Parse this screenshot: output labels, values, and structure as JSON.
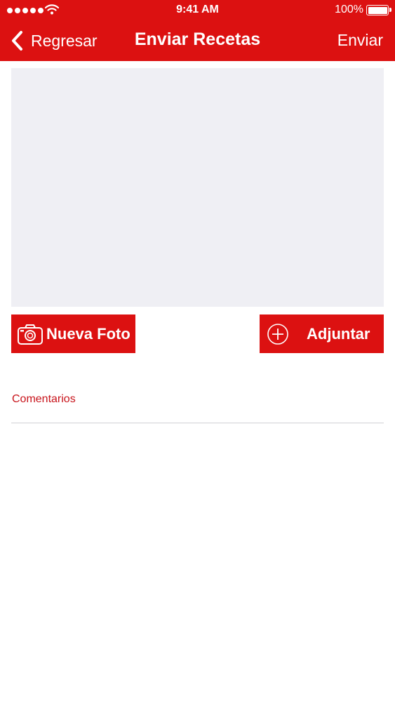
{
  "status_bar": {
    "time": "9:41 AM",
    "battery_percent": "100%",
    "signal_bars": 5
  },
  "nav": {
    "back_label": "Regresar",
    "title": "Enviar Recetas",
    "send_label": "Enviar"
  },
  "actions": {
    "new_photo_label": "Nueva Foto",
    "attach_label": "Adjuntar"
  },
  "comments": {
    "label": "Comentarios",
    "value": ""
  },
  "colors": {
    "accent": "#dc1111",
    "label_red": "#c8141b",
    "photo_bg": "#efeff4"
  },
  "icons": {
    "back": "chevron-left-icon",
    "new_photo": "camera-icon",
    "attach": "plus-circle-icon",
    "wifi": "wifi-icon",
    "battery": "battery-icon"
  }
}
